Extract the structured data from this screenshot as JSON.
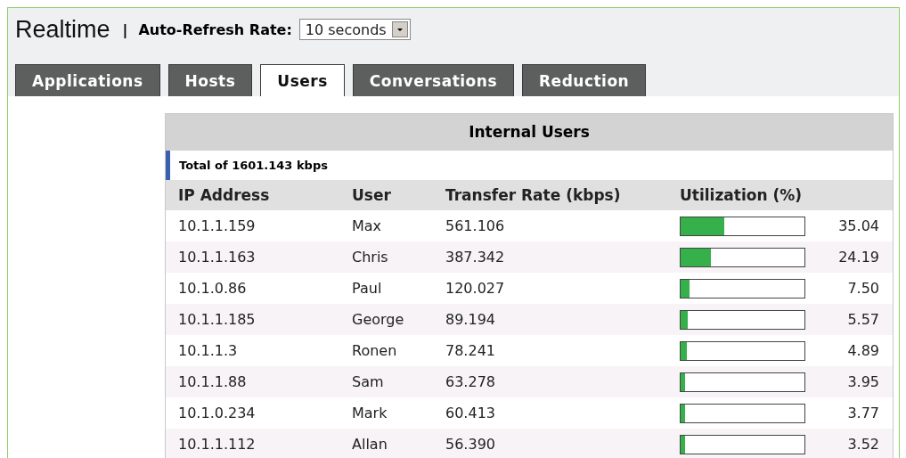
{
  "header": {
    "title": "Realtime",
    "separator": "|",
    "refresh_label": "Auto-Refresh Rate:",
    "refresh_value": "10 seconds"
  },
  "tabs": [
    {
      "label": "Applications",
      "selected": false
    },
    {
      "label": "Hosts",
      "selected": false
    },
    {
      "label": "Users",
      "selected": true
    },
    {
      "label": "Conversations",
      "selected": false
    },
    {
      "label": "Reduction",
      "selected": false
    }
  ],
  "table": {
    "title": "Internal Users",
    "total": "Total of 1601.143 kbps",
    "columns": [
      "IP Address",
      "User",
      "Transfer Rate (kbps)",
      "Utilization (%)"
    ],
    "rows": [
      {
        "ip": "10.1.1.159",
        "user": "Max",
        "rate": "561.106",
        "level": 0.3504,
        "utilization": "35.04"
      },
      {
        "ip": "10.1.1.163",
        "user": "Chris",
        "rate": "387.342",
        "level": 0.2419,
        "utilization": "24.19"
      },
      {
        "ip": "10.1.0.86",
        "user": "Paul",
        "rate": "120.027",
        "level": 0.075,
        "utilization": "7.50"
      },
      {
        "ip": "10.1.1.185",
        "user": "George",
        "rate": "89.194",
        "level": 0.0557,
        "utilization": "5.57"
      },
      {
        "ip": "10.1.1.3",
        "user": "Ronen",
        "rate": "78.241",
        "level": 0.0489,
        "utilization": "4.89"
      },
      {
        "ip": "10.1.1.88",
        "user": "Sam",
        "rate": "63.278",
        "level": 0.0395,
        "utilization": "3.95"
      },
      {
        "ip": "10.1.0.234",
        "user": "Mark",
        "rate": "60.413",
        "level": 0.0377,
        "utilization": "3.77"
      },
      {
        "ip": "10.1.1.112",
        "user": "Allan",
        "rate": "56.390",
        "level": 0.0352,
        "utilization": "3.52"
      }
    ]
  }
}
